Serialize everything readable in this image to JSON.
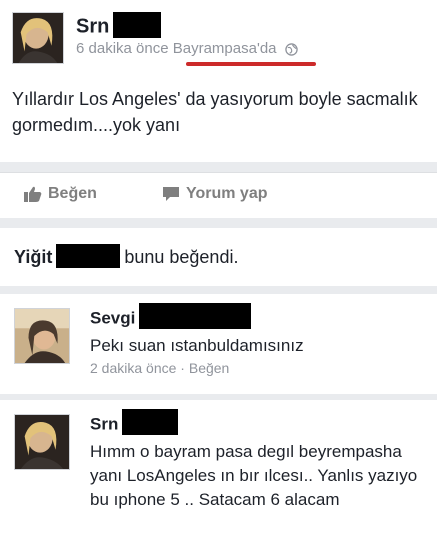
{
  "post": {
    "author": "Srn",
    "time": "6 dakika önce",
    "location": "Bayrampasa'da",
    "text": "Yıllardır Los Angeles' da yasıyorum boyle sacmalık gormedım....yok yanı"
  },
  "actions": {
    "like_label": "Beğen",
    "comment_label": "Yorum yap"
  },
  "likes": {
    "name": "Yiğit",
    "text": "bunu beğendi."
  },
  "comments": [
    {
      "author": "Sevgi",
      "text": "Pekı suan ıstanbuldamısınız",
      "time": "2 dakika önce",
      "separator": "·",
      "like_label": "Beğen"
    },
    {
      "author": "Srn",
      "text": "Hımm o bayram pasa degıl beyrempasha yanı LosAngeles ın bır ılcesı.. Yanlıs yazıyo bu  ıphone 5 .. Satacam 6 alacam"
    }
  ],
  "colors": {
    "background": "#e9ebee",
    "card": "#ffffff",
    "meta_gray": "#90949c",
    "annotation_red": "#cc2a2a",
    "redaction": "#000000"
  }
}
